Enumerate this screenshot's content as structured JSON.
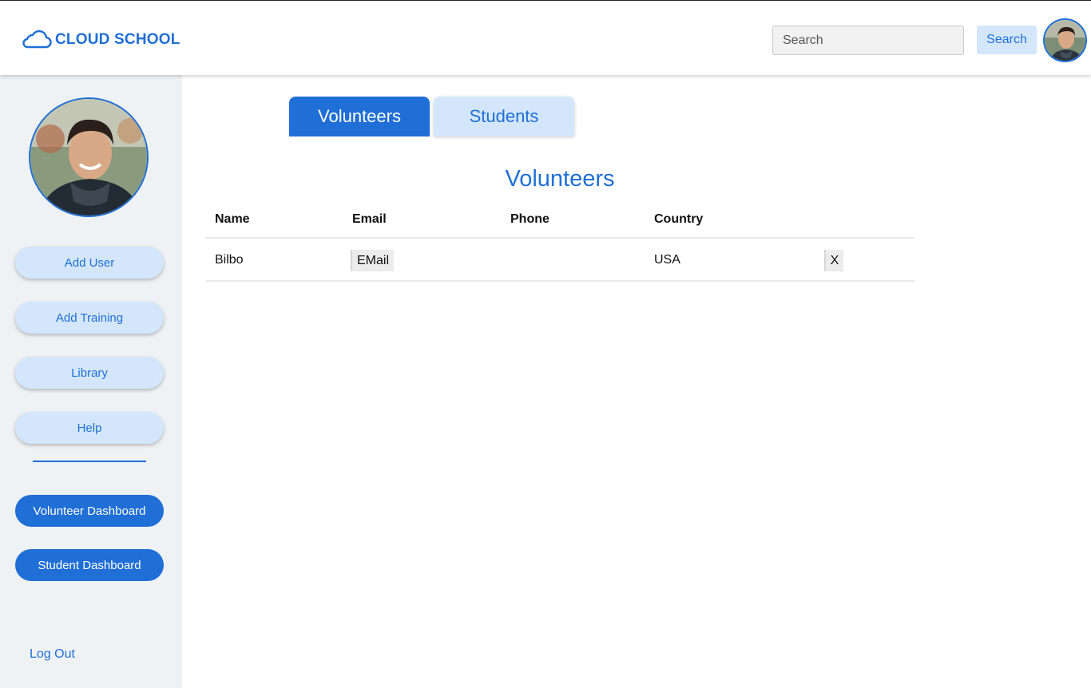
{
  "header": {
    "logo_text": "CLOUD SCHOOL",
    "search_placeholder": "Search",
    "search_value": "",
    "search_button": "Search"
  },
  "sidebar": {
    "buttons": [
      {
        "label": "Add User"
      },
      {
        "label": "Add Training"
      },
      {
        "label": "Library"
      },
      {
        "label": "Help"
      }
    ],
    "dashboards": [
      {
        "label": "Volunteer Dashboard"
      },
      {
        "label": "Student Dashboard"
      }
    ],
    "logout": "Log Out"
  },
  "main": {
    "tabs": [
      {
        "label": "Volunteers",
        "active": true
      },
      {
        "label": "Students",
        "active": false
      }
    ],
    "section_title": "Volunteers",
    "table": {
      "columns": [
        "Name",
        "Email",
        "Phone",
        "Country"
      ],
      "rows": [
        {
          "name": "Bilbo",
          "email_button": "EMail",
          "phone": "",
          "country": "USA",
          "delete_button": "X"
        }
      ]
    }
  },
  "colors": {
    "accent": "#1f6fd6",
    "accent_light": "#d3e6fb",
    "sidebar_bg": "#eff2f5"
  }
}
